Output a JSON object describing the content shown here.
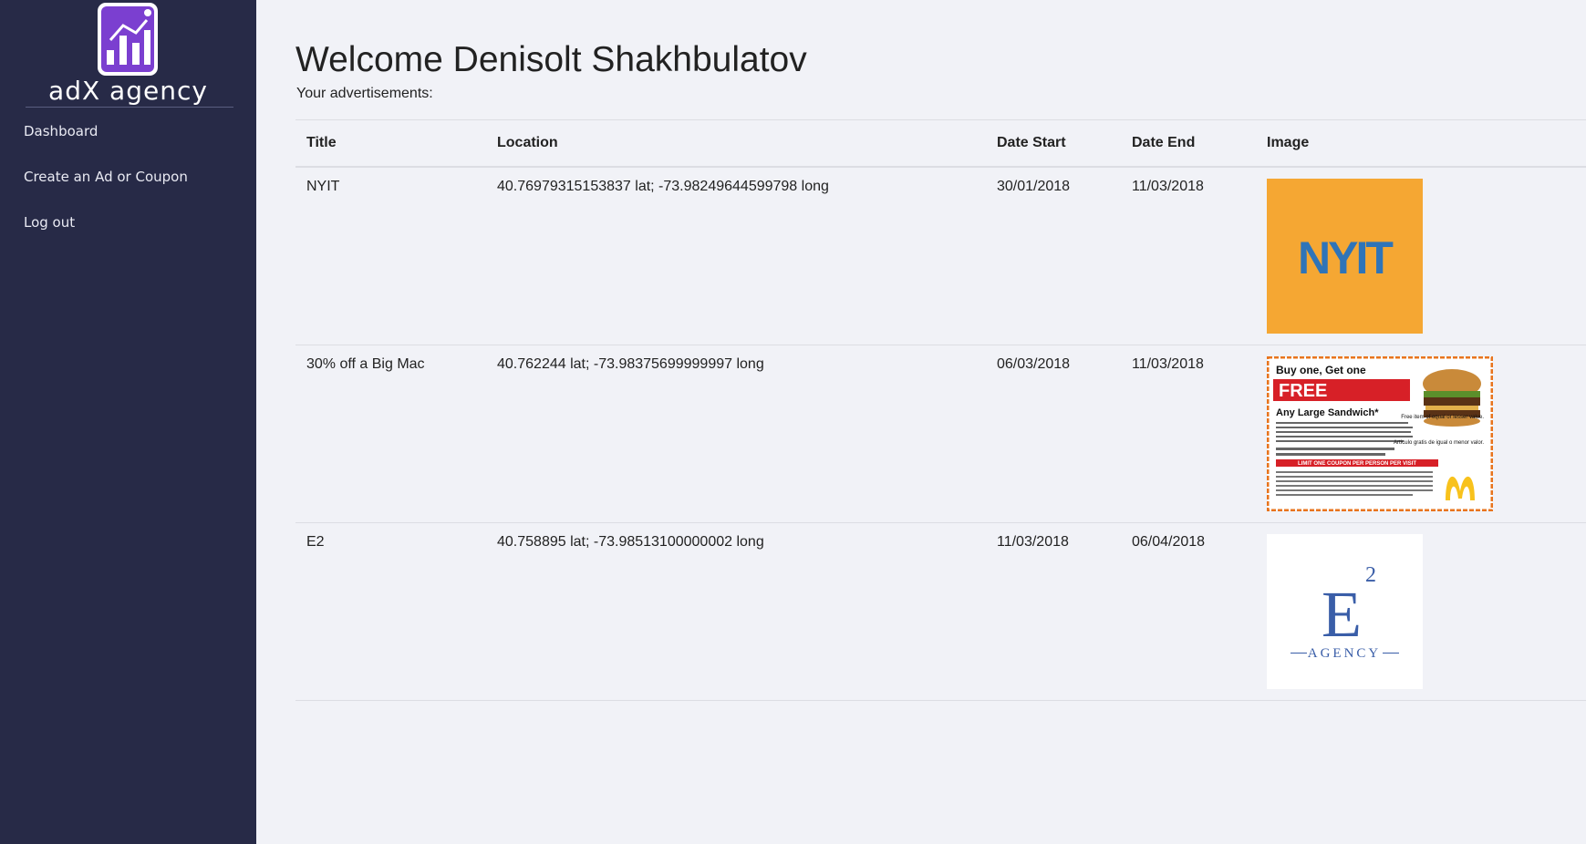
{
  "brand": {
    "name": "adX agency",
    "logo_icon": "bar-chart-icon",
    "accent": "#7b3fd0"
  },
  "sidebar": {
    "items": [
      {
        "label": "Dashboard"
      },
      {
        "label": "Create an Ad or Coupon"
      },
      {
        "label": "Log out"
      }
    ]
  },
  "main": {
    "welcome": "Welcome Denisolt Shakhbulatov",
    "subtitle": "Your advertisements:",
    "table": {
      "headers": [
        "Title",
        "Location",
        "Date Start",
        "Date End",
        "Image"
      ],
      "rows": [
        {
          "title": "NYIT",
          "location": "40.76979315153837 lat; -73.98249644599798 long",
          "date_start": "30/01/2018",
          "date_end": "11/03/2018",
          "image": {
            "logo_text": "NYIT",
            "bg": "#f5a733",
            "fg": "#2f74b8"
          }
        },
        {
          "title": "30% off a Big Mac",
          "location": "40.762244 lat; -73.98375699999997 long",
          "date_start": "06/03/2018",
          "date_end": "11/03/2018",
          "image": {
            "line1": "Buy one, Get one",
            "free": "FREE",
            "line2": "Any Large Sandwich*",
            "side1": "Free item of equal or lesser value.",
            "side2": "Artículo gratis de igual o menor valor.",
            "limit": "LIMIT ONE COUPON PER PERSON PER VISIT",
            "border": "#e8741d",
            "red": "#d72027",
            "gold": "#f8c21c"
          }
        },
        {
          "title": "E2",
          "location": "40.758895 lat; -73.98513100000002 long",
          "date_start": "11/03/2018",
          "date_end": "06/04/2018",
          "image": {
            "logo_letter": "E",
            "logo_sup": "2",
            "logo_sub": "AGENCY",
            "fg": "#3a5ea8"
          }
        }
      ]
    }
  }
}
